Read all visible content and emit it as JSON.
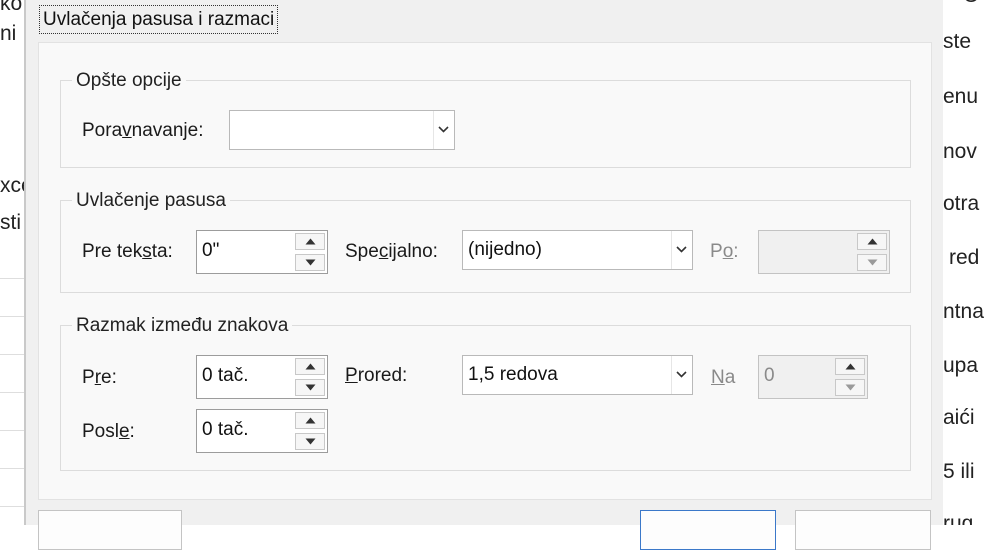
{
  "background": {
    "left_fragments": [
      "ko",
      "ni",
      "xce",
      "sti"
    ],
    "right_fragments": [
      "O",
      "ste",
      "enu",
      "nov",
      "otra",
      "red",
      "ntna",
      "upa",
      "aići",
      "5 ili",
      "rug"
    ]
  },
  "dialog": {
    "tab_title": "Uvlačenja pasusa i razmaci",
    "general": {
      "legend": "Opšte opcije",
      "alignment_label_parts": [
        "Pora",
        "v",
        "navanje:"
      ],
      "alignment_value": ""
    },
    "indentation": {
      "legend": "Uvlačenje pasusa",
      "before_text_label_parts": [
        "Pre tek",
        "s",
        "ta:"
      ],
      "before_text_value": "0\"",
      "special_label_parts": [
        "Spe",
        "c",
        "ijalno:"
      ],
      "special_value": "(nijedno)",
      "by_label_parts": [
        "P",
        "o",
        ":"
      ],
      "by_value": ""
    },
    "spacing": {
      "legend": "Razmak između znakova",
      "before_label_parts": [
        "P",
        "r",
        "e:"
      ],
      "before_value": "0 tač.",
      "after_label_parts": [
        "Posl",
        "e",
        ":"
      ],
      "after_value": "0 tač.",
      "line_spacing_label_parts": [
        "",
        "P",
        "rored:"
      ],
      "line_spacing_value": "1,5 redova",
      "at_label_parts": [
        "",
        "N",
        "a"
      ],
      "at_value": "0"
    }
  },
  "colors": {
    "dialog_bg": "#f0f0f0",
    "panel_bg": "#f9f9f9",
    "primary_button_border": "#3b78c9"
  }
}
